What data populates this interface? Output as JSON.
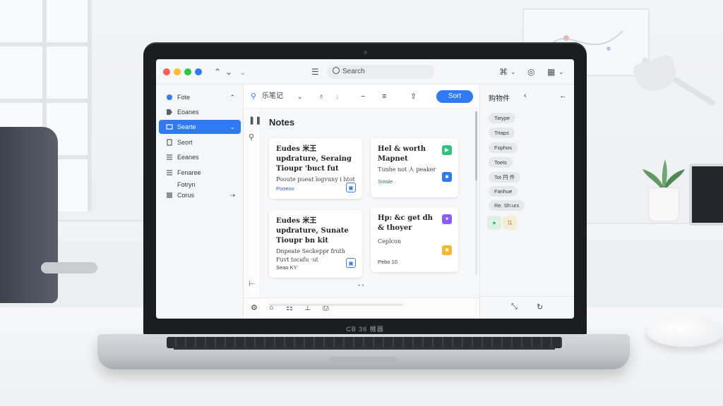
{
  "brand": "CB 36 機器",
  "app": {
    "titlebar": {
      "nav_back": "⌃",
      "nav_forward": "⌄",
      "list_icon": "☰",
      "search_text": "Search",
      "share_icon": "⌘",
      "account_icon": "◎",
      "calendar_icon": "▦"
    },
    "sidebar": {
      "items": [
        {
          "label": "Fote",
          "icon": "circle-icon"
        },
        {
          "label": "Eoanes",
          "icon": "tag-icon"
        },
        {
          "label": "Searte",
          "icon": "folder-icon"
        },
        {
          "label": "Seort",
          "icon": "doc-icon"
        },
        {
          "label": "Eeanes",
          "icon": "list-icon"
        },
        {
          "label": "Fenaree",
          "icon": "list-icon"
        },
        {
          "label": "Fotryn",
          "icon": ""
        },
        {
          "label": "Corus",
          "icon": "grid-icon"
        }
      ],
      "more": "⇢"
    },
    "toolbar": {
      "notebook": "乐笔记",
      "sort_label": "Sort"
    },
    "main": {
      "title": "Notes",
      "cards": [
        {
          "title": "Eudes 米王 updrature, Seraing Tioupr 'buct fut",
          "snippet": "Pooute pueat logvuny i htot",
          "footer": "Pooeoo ·",
          "badge": "▣",
          "badge_color": "#3a7be8"
        },
        {
          "title": "Hel & worth Mapnet",
          "snippet": "Tunhe not 人 peaker",
          "footer": "Sotale ·",
          "badge": "▶",
          "badge_color": "#2ec47a",
          "badge2": "■",
          "badge2_color": "#2f7bf5"
        },
        {
          "title": "Eudes 米王 updrature, Sunate Tioupr bn kit",
          "snippet": "Dnpeate Seckeppr fruth Fuvt tocafu ·ut",
          "footer": "Seao KY",
          "badge": "▣",
          "badge_color": "#3a7be8"
        },
        {
          "title": "Hp: &c get dh & thoyer",
          "snippet": "Ceplcon",
          "footer": "Pebo 10",
          "badge": "▾",
          "badge_color": "#8b5cf6",
          "badge2": "■",
          "badge2_color": "#f5b82e"
        }
      ]
    },
    "right_panel": {
      "title": "购物件",
      "tags": [
        "Tieype",
        "Trtaps",
        "Fophos",
        "Toets",
        "Tot 円 件",
        "Fanhue",
        "Re. Sh:urs"
      ]
    }
  }
}
